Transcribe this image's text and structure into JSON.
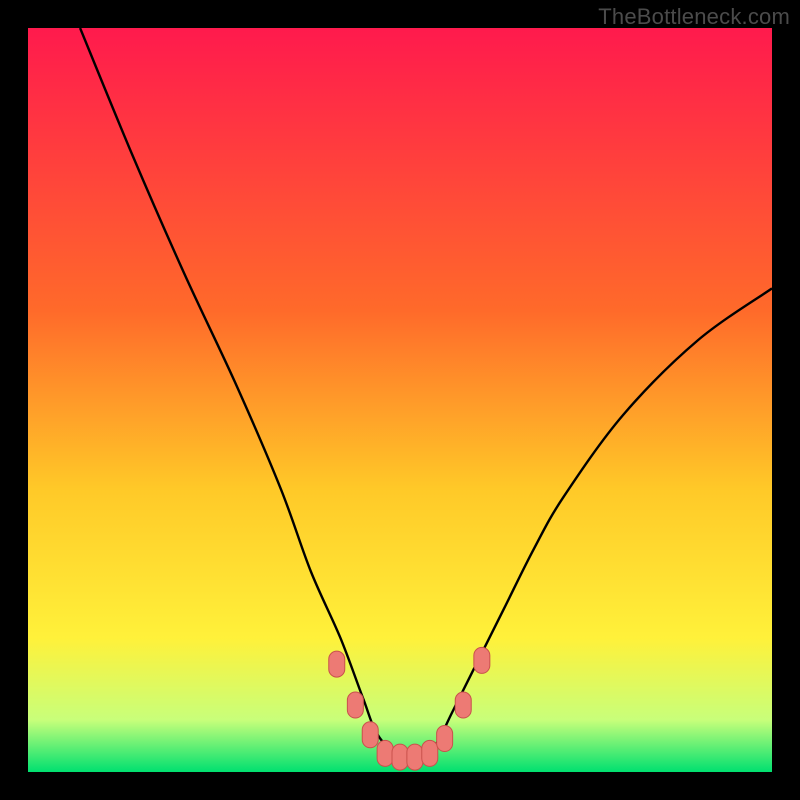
{
  "watermark": "TheBottleneck.com",
  "colors": {
    "frame": "#000000",
    "grad_top": "#ff1a4d",
    "grad_mid1": "#ff6a2a",
    "grad_mid2": "#ffc928",
    "grad_mid3": "#fff13a",
    "grad_bottom1": "#c8ff7a",
    "grad_bottom2": "#00e070",
    "curve": "#000000",
    "marker_fill": "#ed7a74",
    "marker_stroke": "#c9514c"
  },
  "chart_data": {
    "type": "line",
    "title": "",
    "xlabel": "",
    "ylabel": "",
    "xlim": [
      0,
      100
    ],
    "ylim": [
      0,
      100
    ],
    "series": [
      {
        "name": "curve",
        "x": [
          7,
          14,
          21,
          28,
          34,
          38,
          42,
          45,
          47,
          50,
          53,
          55,
          57,
          60,
          64,
          68,
          72,
          80,
          90,
          100
        ],
        "y": [
          100,
          83,
          67,
          52,
          38,
          27,
          18,
          10,
          5,
          2,
          2,
          4,
          8,
          14,
          22,
          30,
          37,
          48,
          58,
          65
        ]
      }
    ],
    "markers": {
      "name": "highlighted-points",
      "points": [
        {
          "x": 41.5,
          "y": 14.5
        },
        {
          "x": 44,
          "y": 9
        },
        {
          "x": 46,
          "y": 5
        },
        {
          "x": 48,
          "y": 2.5
        },
        {
          "x": 50,
          "y": 2
        },
        {
          "x": 52,
          "y": 2
        },
        {
          "x": 54,
          "y": 2.5
        },
        {
          "x": 56,
          "y": 4.5
        },
        {
          "x": 58.5,
          "y": 9
        },
        {
          "x": 61,
          "y": 15
        }
      ]
    }
  }
}
